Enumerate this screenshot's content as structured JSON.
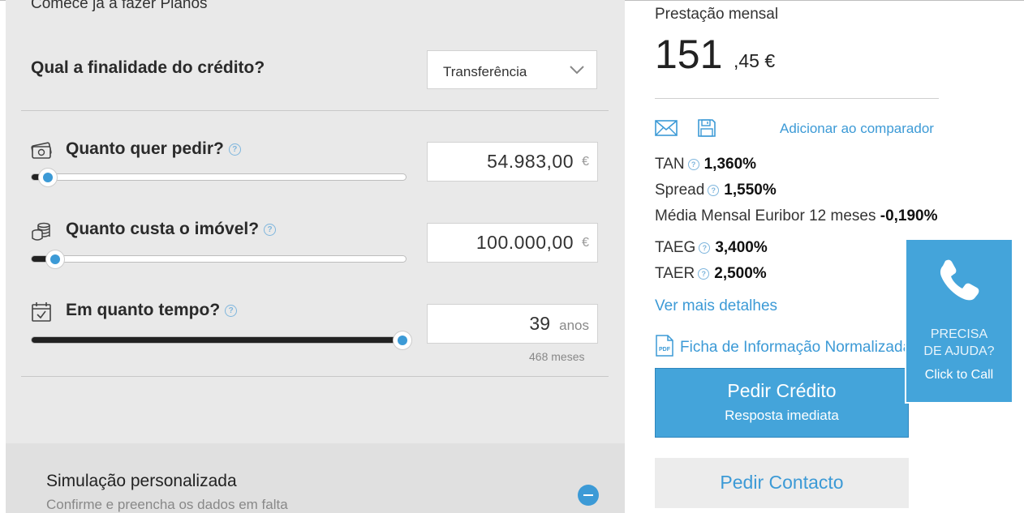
{
  "form": {
    "intro": "Comece já a fazer Planos",
    "finalidade": {
      "question": "Qual a finalidade do crédito?",
      "selected": "Transferência"
    },
    "pedir": {
      "question": "Quanto quer pedir?",
      "help": "?",
      "value": "54.983,00",
      "unit": "€",
      "slider_fraction": 0.03
    },
    "imovel": {
      "question": "Quanto custa o imóvel?",
      "help": "?",
      "value": "100.000,00",
      "unit": "€",
      "slider_fraction": 0.05
    },
    "tempo": {
      "question": "Em quanto tempo?",
      "help": "?",
      "value": "39",
      "unit": "anos",
      "months": "468 meses",
      "slider_fraction": 1.0
    }
  },
  "simulation": {
    "title": "Simulação personalizada",
    "subtitle": "Confirme e preencha os dados em falta"
  },
  "result": {
    "label": "Prestação mensal",
    "amount_int": "151",
    "amount_dec": ",45 €",
    "compare_link": "Adicionar ao comparador",
    "rates": [
      {
        "label": "TAN",
        "value": "1,360%",
        "help": true
      },
      {
        "label": "Spread",
        "value": "1,550%",
        "help": true
      },
      {
        "label": "Média Mensal Euribor 12 meses",
        "value": "-0,190%",
        "help": false
      },
      {
        "label": "TAEG",
        "value": "3,400%",
        "help": true
      },
      {
        "label": "TAER",
        "value": "2,500%",
        "help": true
      }
    ],
    "details_link": "Ver mais detalhes",
    "ficha_link": "Ficha de Informação Normalizada",
    "pdf_icon_text": "PDF"
  },
  "actions": {
    "credit_title": "Pedir Crédito",
    "credit_sub": "Resposta imediata",
    "contact": "Pedir Contacto"
  },
  "help_widget": {
    "line1": "PRECISA",
    "line2": "DE AJUDA?",
    "line3": "Click to Call"
  },
  "colors": {
    "accent": "#44a4da",
    "link": "#3c9ad6",
    "panel": "#e9e9e9"
  }
}
